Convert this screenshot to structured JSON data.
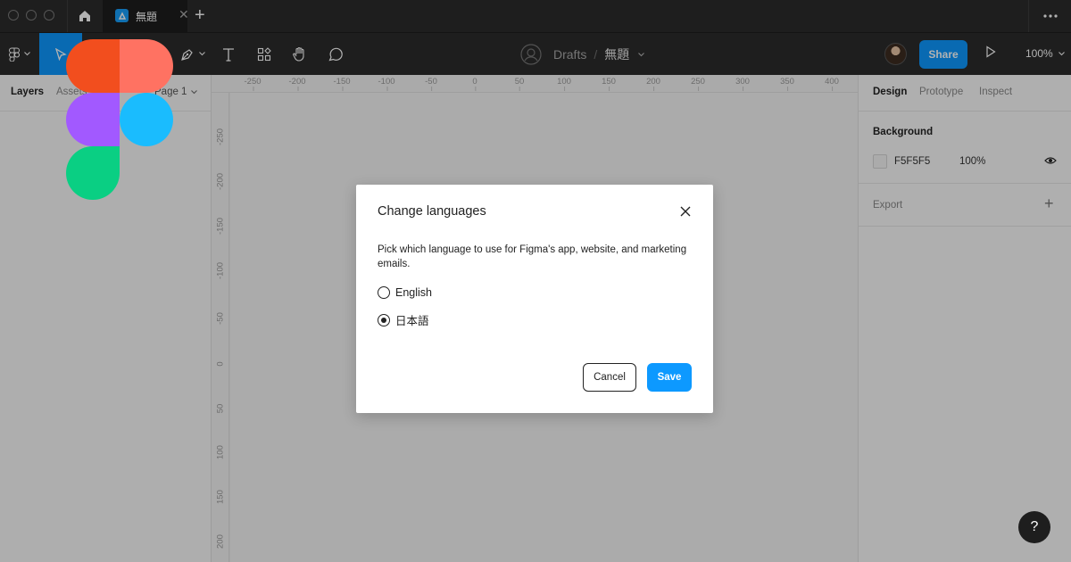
{
  "tabbar": {
    "file_tab_label": "無題",
    "file_tab_close": "✕",
    "new_tab": "+"
  },
  "toolbar": {
    "breadcrumb_drafts": "Drafts",
    "breadcrumb_sep": "/",
    "breadcrumb_file": "無題",
    "share_label": "Share",
    "zoom_label": "100%"
  },
  "left_panel": {
    "tab_layers": "Layers",
    "tab_assets": "Assets",
    "page_select": "Page 1"
  },
  "rulers": {
    "horizontal": [
      "-250",
      "-200",
      "-150",
      "-100",
      "-50",
      "0",
      "50",
      "100",
      "150",
      "200",
      "250",
      "300",
      "350",
      "400"
    ],
    "vertical": [
      "-250",
      "-200",
      "-150",
      "-100",
      "-50",
      "0",
      "50",
      "100",
      "150",
      "200"
    ]
  },
  "right_panel": {
    "tab_design": "Design",
    "tab_prototype": "Prototype",
    "tab_inspect": "Inspect",
    "background_title": "Background",
    "background_hex": "F5F5F5",
    "background_opacity": "100%",
    "export_title": "Export",
    "export_add": "+"
  },
  "modal": {
    "title": "Change languages",
    "description": "Pick which language to use for Figma's app, website, and marketing emails.",
    "options": [
      {
        "label": "English",
        "checked": false
      },
      {
        "label": "日本語",
        "checked": true
      }
    ],
    "cancel_label": "Cancel",
    "save_label": "Save"
  },
  "help_label": "?",
  "colors": {
    "accent": "#0D99FF",
    "chrome": "#2C2C2C",
    "canvas": "#F5F5F5",
    "logo_red": "#F24E1E",
    "logo_orange": "#FF7262",
    "logo_purple": "#A259FF",
    "logo_blue": "#1ABCFE",
    "logo_green": "#0ACF83"
  },
  "icons": [
    "home-icon",
    "figma-file-icon",
    "close-icon",
    "plus-icon",
    "more-icon",
    "figma-menu-icon",
    "move-tool-icon",
    "pen-tool-icon",
    "text-tool-icon",
    "resources-icon",
    "hand-tool-icon",
    "comment-icon",
    "user-circle-icon",
    "play-icon",
    "eye-icon",
    "help-icon"
  ]
}
